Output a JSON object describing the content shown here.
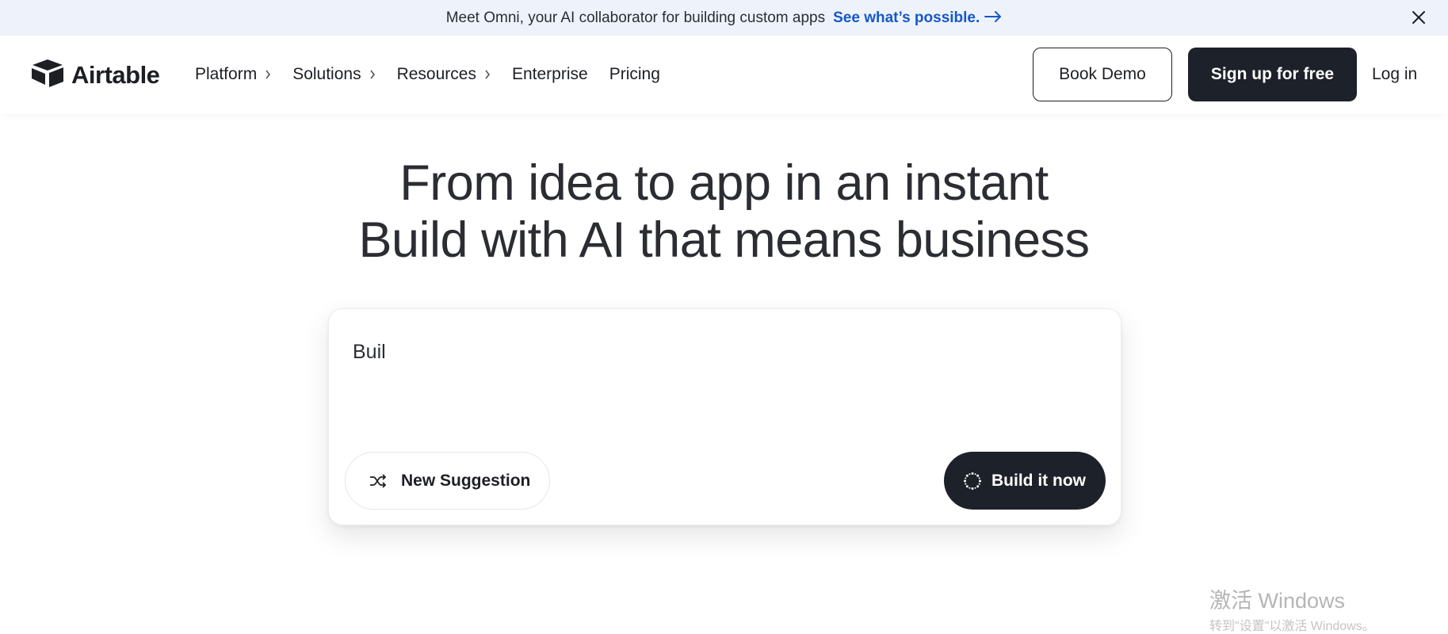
{
  "banner": {
    "message": "Meet Omni, your AI collaborator for building custom apps",
    "cta_label": "See what’s possible.",
    "cta_icon": "arrow-right-icon",
    "close_icon": "close-icon"
  },
  "nav": {
    "logo_text": "Airtable",
    "items": [
      {
        "label": "Platform",
        "has_chevron": true
      },
      {
        "label": "Solutions",
        "has_chevron": true
      },
      {
        "label": "Resources",
        "has_chevron": true
      },
      {
        "label": "Enterprise",
        "has_chevron": false
      },
      {
        "label": "Pricing",
        "has_chevron": false
      }
    ],
    "book_demo_label": "Book Demo",
    "signup_label": "Sign up for free",
    "login_label": "Log in"
  },
  "hero": {
    "line1": "From idea to app in an instant",
    "line2": "Build with AI that means business"
  },
  "prompt_card": {
    "input_value": "Buil",
    "new_suggestion_label": "New Suggestion",
    "new_suggestion_icon": "shuffle-icon",
    "build_label": "Build it now",
    "build_icon": "sparkle-loader-icon"
  },
  "watermark": {
    "line1": "激活 Windows",
    "line2": "转到\"设置\"以激活 Windows。"
  },
  "colors": {
    "banner_bg": "#eef3fb",
    "link_blue": "#1558c7",
    "dark_button": "#1d2129",
    "text": "#1d1f25"
  }
}
